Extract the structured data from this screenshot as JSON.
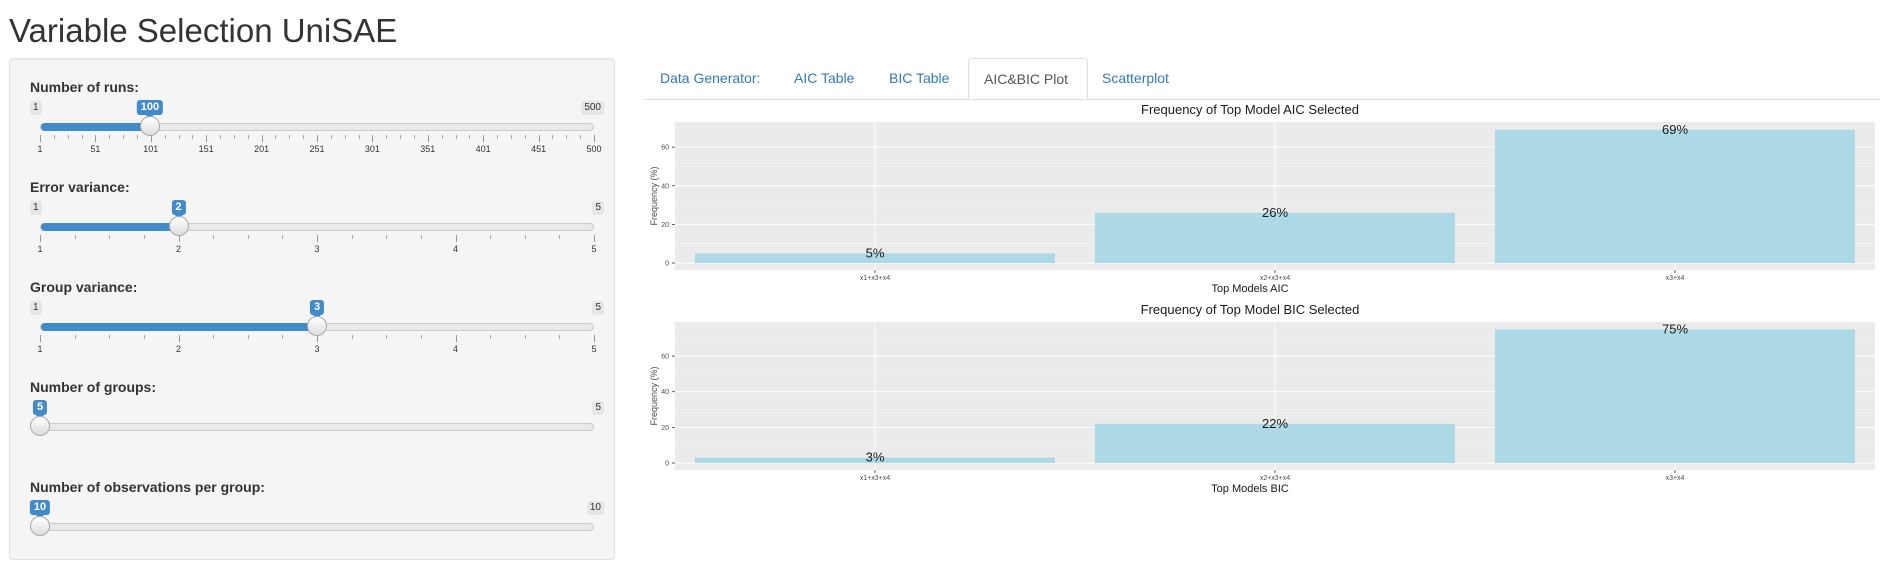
{
  "app": {
    "title": "Variable Selection UniSAE"
  },
  "sidebar": {
    "sliders": [
      {
        "label": "Number of runs:",
        "min": 1,
        "max": 500,
        "value": 100,
        "min_label": "1",
        "max_label": "500",
        "value_label": "100",
        "ticks": [
          "1",
          "51",
          "101",
          "151",
          "201",
          "251",
          "301",
          "351",
          "401",
          "451",
          "500"
        ]
      },
      {
        "label": "Error variance:",
        "min": 1,
        "max": 5,
        "value": 2,
        "min_label": "1",
        "max_label": "5",
        "value_label": "2",
        "ticks": [
          "1",
          "2",
          "3",
          "4",
          "5"
        ]
      },
      {
        "label": "Group variance:",
        "min": 1,
        "max": 5,
        "value": 3,
        "min_label": "1",
        "max_label": "5",
        "value_label": "3",
        "ticks": [
          "1",
          "2",
          "3",
          "4",
          "5"
        ]
      },
      {
        "label": "Number of groups:",
        "min": 5,
        "max": 5,
        "value": 5,
        "min_label": "",
        "max_label": "5",
        "value_label": "5",
        "ticks": []
      },
      {
        "label": "Number of observations per group:",
        "min": 10,
        "max": 10,
        "value": 10,
        "min_label": "",
        "max_label": "10",
        "value_label": "10",
        "ticks": []
      }
    ]
  },
  "tabs": [
    {
      "label": "Data Generator:",
      "active": false
    },
    {
      "label": "AIC Table",
      "active": false
    },
    {
      "label": "BIC Table",
      "active": false
    },
    {
      "label": "AIC&BIC Plot",
      "active": true
    },
    {
      "label": "Scatterplot",
      "active": false
    }
  ],
  "colors": {
    "accent": "#428bca",
    "bar": "#add8e6",
    "panel_bg": "#ebebeb",
    "link": "#337ab7"
  },
  "chart_data": [
    {
      "type": "bar",
      "title": "Frequency of Top Model AIC Selected",
      "xlabel": "Top Models AIC",
      "ylabel": "Frequency (%)",
      "categories": [
        "x1+x3+x4",
        "x2+x3+x4",
        "x3+x4"
      ],
      "values": [
        5,
        26,
        69
      ],
      "data_labels": [
        "5%",
        "26%",
        "69%"
      ],
      "yticks": [
        0,
        20,
        40,
        60
      ],
      "ylim": [
        0,
        72
      ],
      "grid": true
    },
    {
      "type": "bar",
      "title": "Frequency of Top Model BIC Selected",
      "xlabel": "Top Models BIC",
      "ylabel": "Frequency (%)",
      "categories": [
        "x1+x3+x4",
        "x2+x3+x4",
        "x3+x4"
      ],
      "values": [
        3,
        22,
        75
      ],
      "data_labels": [
        "3%",
        "22%",
        "75%"
      ],
      "yticks": [
        0,
        20,
        40,
        60
      ],
      "ylim": [
        0,
        78
      ],
      "grid": true
    }
  ]
}
